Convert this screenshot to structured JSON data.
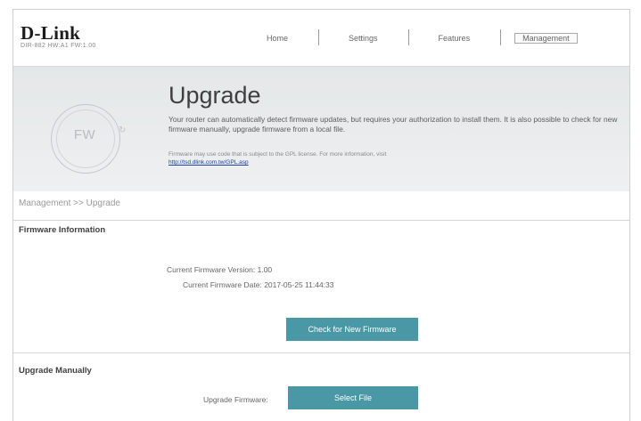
{
  "header": {
    "logo": "D-Link",
    "model": "DIR-882 HW:A1 FW:1.00",
    "nav": [
      "Home",
      "Settings",
      "Features",
      "Management"
    ],
    "active_nav": "Management"
  },
  "banner": {
    "icon_label": "FW",
    "title": "Upgrade",
    "description": "Your router can automatically detect firmware updates, but requires your authorization to install them. It is also possible to check for new firmware manually, upgrade firmware from a local file.",
    "gpl_text": "Firmware may use code that is subject to the GPL license. For more information, visit",
    "gpl_link": "http://tsd.dlink.com.tw/GPL.asp"
  },
  "breadcrumb": "Management >> Upgrade",
  "firmware_info": {
    "section_title": "Firmware Information",
    "version_label": "Current Firmware Version:",
    "version_value": "1.00",
    "date_label": "Current Firmware Date:",
    "date_value": "2017-05-25 11:44:33",
    "check_button": "Check for New Firmware"
  },
  "upgrade_manual": {
    "section_title": "Upgrade Manually",
    "field_label": "Upgrade Firmware:",
    "select_button": "Select File"
  },
  "colors": {
    "button": "#4a97a6",
    "banner": "#e8ebec",
    "link": "#1a3ea8"
  }
}
